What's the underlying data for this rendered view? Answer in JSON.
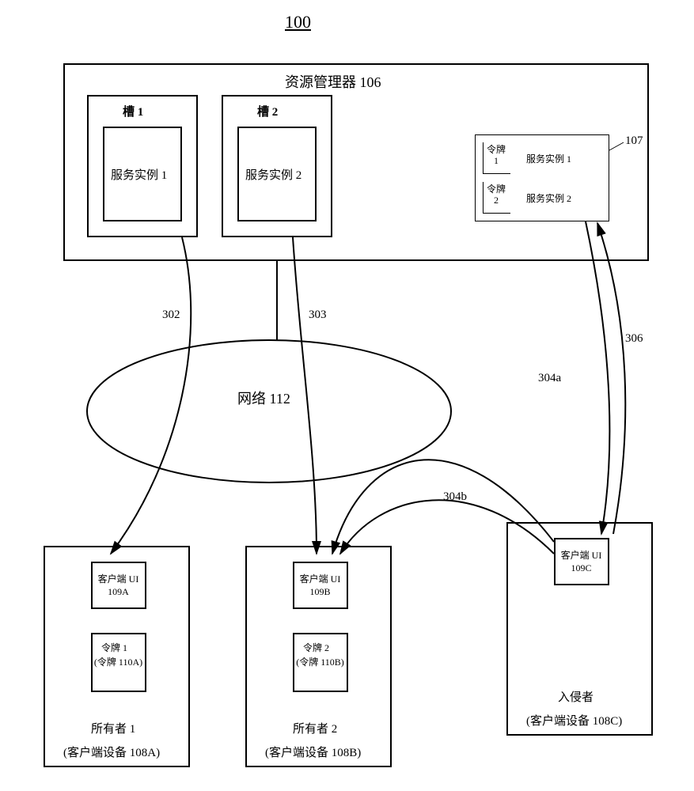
{
  "figure_number": "100",
  "resource_manager": {
    "title": "资源管理器 106",
    "slot1": {
      "label": "槽 1",
      "service": "服务实例 1"
    },
    "slot2": {
      "label": "槽 2",
      "service": "服务实例 2"
    },
    "table": {
      "ref": "107",
      "rows": [
        {
          "token": "令牌 1",
          "service": "服务实例 1"
        },
        {
          "token": "令牌 2",
          "service": "服务实例 2"
        }
      ]
    }
  },
  "network": {
    "label": "网络 112"
  },
  "arrows": {
    "a302": "302",
    "a303": "303",
    "a304a": "304a",
    "a304b": "304b",
    "a306": "306"
  },
  "clients": {
    "owner1": {
      "ui": "客户端 UI 109A",
      "token": "令牌 1",
      "token_detail": "(令牌 110A)",
      "name": "所有者 1",
      "device": "(客户端设备 108A)"
    },
    "owner2": {
      "ui": "客户端 UI 109B",
      "token": "令牌 2",
      "token_detail": "(令牌 110B)",
      "name": "所有者 2",
      "device": "(客户端设备 108B)"
    },
    "intruder": {
      "ui": "客户端 UI 109C",
      "name": "入侵者",
      "device": "(客户端设备 108C)"
    }
  }
}
